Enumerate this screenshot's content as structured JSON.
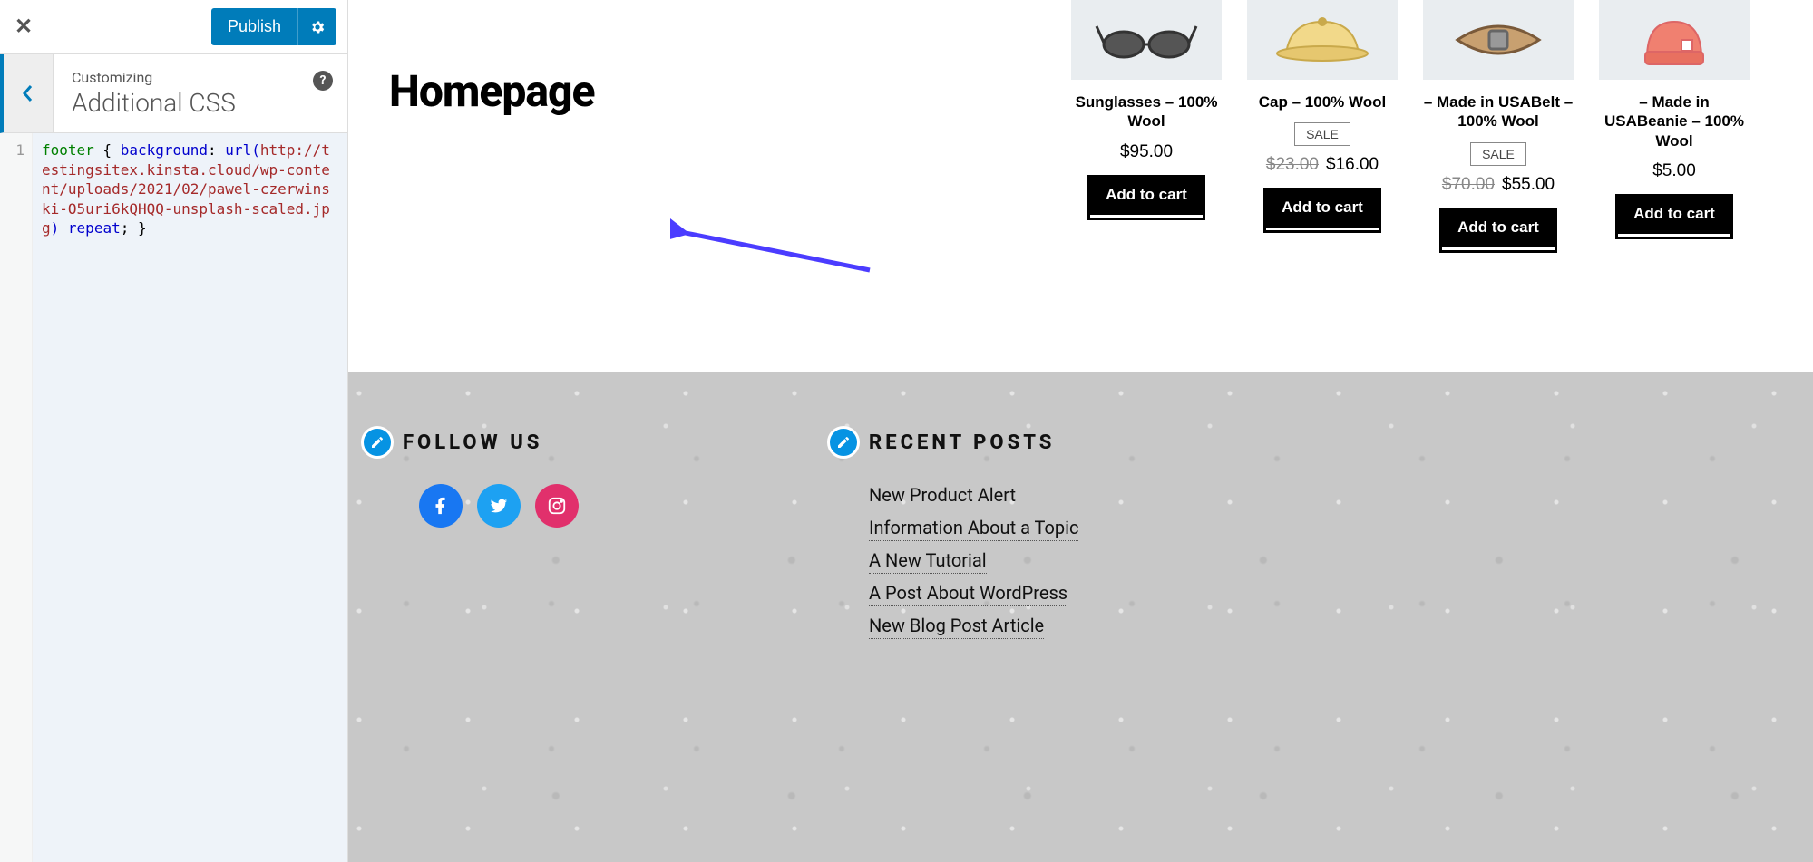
{
  "customizer": {
    "publish_label": "Publish",
    "customizing_label": "Customizing",
    "section_title": "Additional CSS",
    "line_number": "1",
    "code_selector": "footer",
    "code_brace_open": " { ",
    "code_prop": "background",
    "code_colon": ": ",
    "code_url_fn": "url(",
    "code_url": "http://testingsitex.kinsta.cloud/wp-content/uploads/2021/02/pawel-czerwinski-O5uri6kQHQQ-unsplash-scaled.jpg",
    "code_url_close": ")",
    "code_repeat": " repeat",
    "code_brace_close": "; }"
  },
  "page": {
    "title": "Homepage"
  },
  "labels": {
    "sale": "SALE",
    "add_to_cart": "Add to cart"
  },
  "products": [
    {
      "name": "Sunglasses – 100% Wool",
      "price": "$95.00",
      "old_price": "",
      "sale": false,
      "icon": "sunglasses"
    },
    {
      "name": "Cap – 100% Wool",
      "price": "$16.00",
      "old_price": "$23.00",
      "sale": true,
      "icon": "cap"
    },
    {
      "name": "– Made in USABelt – 100% Wool",
      "price": "$55.00",
      "old_price": "$70.00",
      "sale": true,
      "icon": "belt"
    },
    {
      "name": "– Made in USABeanie – 100% Wool",
      "price": "$5.00",
      "old_price": "",
      "sale": false,
      "icon": "beanie"
    }
  ],
  "footer": {
    "follow_heading": "FOLLOW US",
    "recent_heading": "RECENT POSTS",
    "posts": [
      "New Product Alert",
      "Information About a Topic",
      "A New Tutorial",
      "A Post About WordPress",
      "New Blog Post Article"
    ]
  }
}
